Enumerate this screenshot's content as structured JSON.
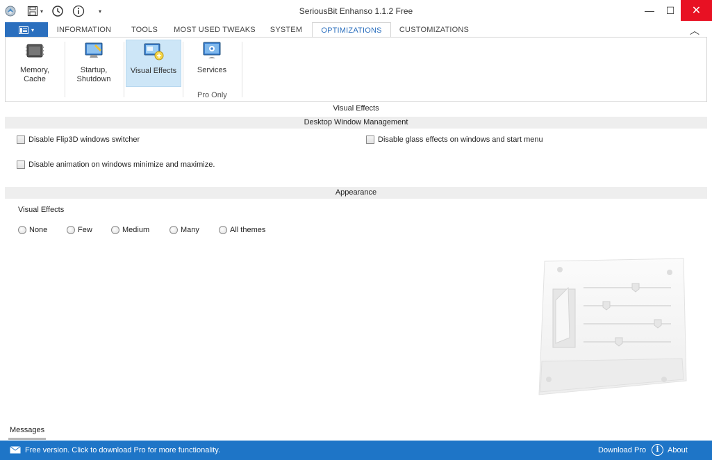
{
  "window": {
    "title": "SeriousBit Enhanso  1.1.2 Free",
    "minimize_glyph": "—",
    "maximize_glyph": "☐",
    "close_glyph": "✕"
  },
  "quick_access": [
    "app-icon",
    "save-icon",
    "history-icon",
    "info-icon",
    "customize-dropdown-icon"
  ],
  "tabs": [
    {
      "label": "INFORMATION"
    },
    {
      "label": "TOOLS"
    },
    {
      "label": "MOST USED TWEAKS"
    },
    {
      "label": "SYSTEM"
    },
    {
      "label": "OPTIMIZATIONS"
    },
    {
      "label": "CUSTOMIZATIONS"
    }
  ],
  "active_tab": "OPTIMIZATIONS",
  "ribbon": {
    "buttons": [
      {
        "label": "Memory,\nCache",
        "icon": "memory-chip-icon"
      },
      {
        "label": "Startup,\nShutdown",
        "icon": "startup-monitor-icon"
      },
      {
        "label": "Visual Effects",
        "icon": "visual-effects-icon"
      },
      {
        "label": "Services",
        "icon": "services-icon"
      }
    ],
    "selected": "Visual Effects",
    "group_label": "Pro Only"
  },
  "content": {
    "title": "Visual Effects",
    "section_dwm": "Desktop Window Management",
    "checkboxes": [
      {
        "label": "Disable Flip3D windows switcher",
        "checked": false
      },
      {
        "label": "Disable glass effects on windows and start menu",
        "checked": false
      },
      {
        "label": "Disable animation on windows minimize and maximize.",
        "checked": false
      }
    ],
    "section_appearance": "Appearance",
    "visual_effects_label": "Visual Effects",
    "radio_options": [
      "None",
      "Few",
      "Medium",
      "Many",
      "All themes"
    ],
    "radio_selected": null
  },
  "messages_label": "Messages",
  "status": {
    "message": "Free version. Click to download Pro for more functionality.",
    "download_pro": "Download Pro",
    "about": "About"
  },
  "colors": {
    "accent_blue": "#1e75c7",
    "file_button": "#2b6fbe",
    "close_red": "#e81123",
    "selected_ribbon": "#cde6f7"
  }
}
